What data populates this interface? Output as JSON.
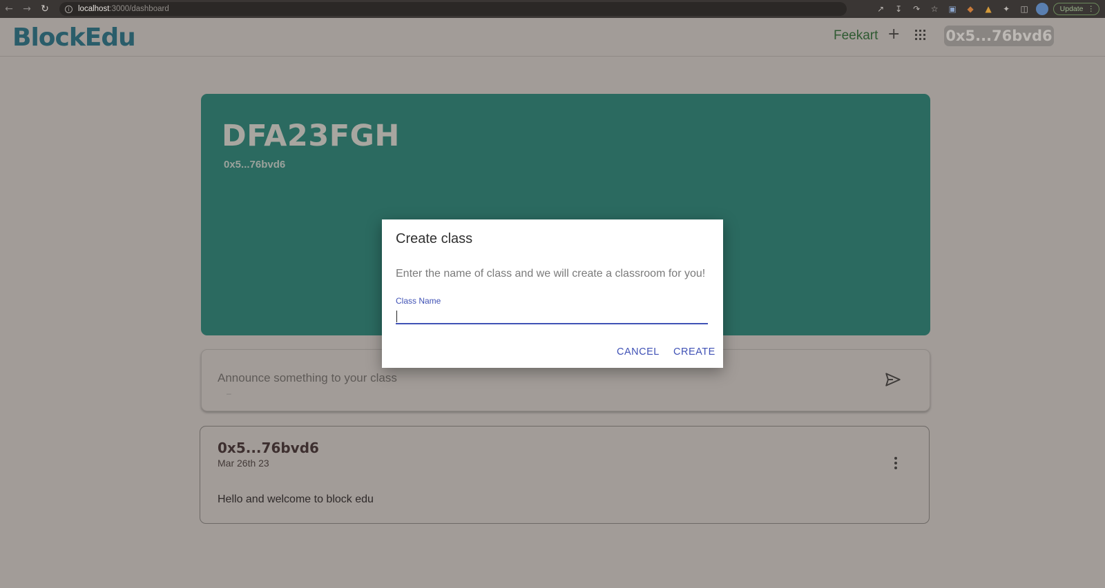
{
  "browser": {
    "back_icon": "arrow-left-icon",
    "forward_icon": "arrow-right-icon",
    "reload_icon": "reload-icon",
    "url_host": "localhost",
    "url_path": ":3000/dashboard",
    "update_label": "Update"
  },
  "header": {
    "logo": "BlockEdu",
    "username": "Feekart",
    "add_symbol": "+",
    "wallet_address": "0x5...76bvd6"
  },
  "banner": {
    "title": "DFA23FGH",
    "owner": "0x5...76bvd6",
    "color": "#2b6a60"
  },
  "announce": {
    "placeholder": "Announce something to your class",
    "dash": "–"
  },
  "post": {
    "author": "0x5...76bvd6",
    "date": "Mar 26th 23",
    "body": "Hello and welcome to block edu"
  },
  "dialog": {
    "title": "Create class",
    "description": "Enter the name of class and we will create a classroom for you!",
    "field_label": "Class Name",
    "field_value": "",
    "cancel_label": "CANCEL",
    "create_label": "CREATE",
    "accent_color": "#3f51b5"
  }
}
